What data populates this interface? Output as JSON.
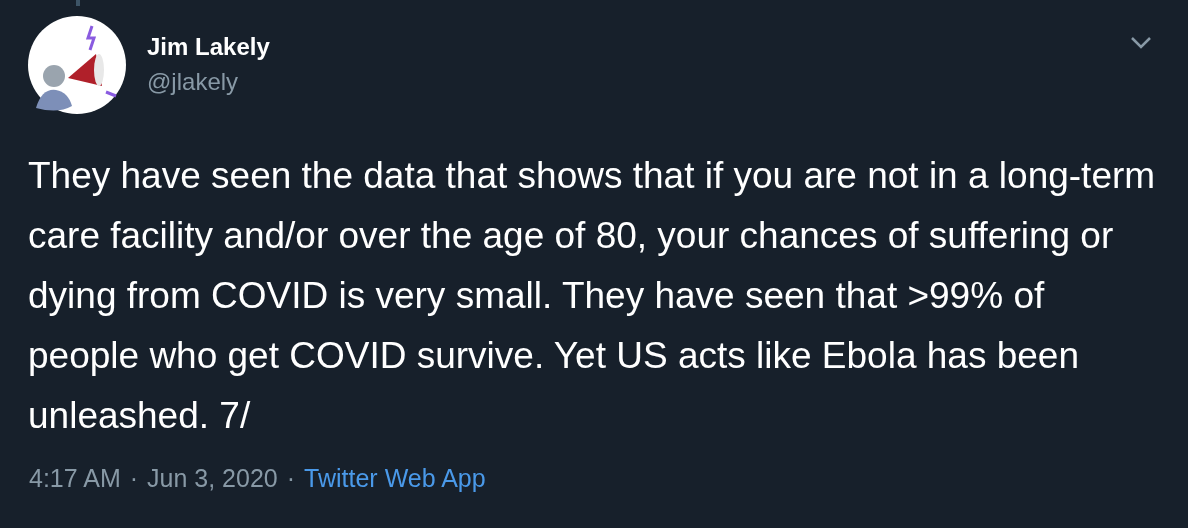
{
  "author": {
    "name": "Jim Lakely",
    "handle": "@jlakely"
  },
  "text": "They have seen the data that shows that if you are not in a long-term care facility and/or over the age of 80, your chances of suffering or dying from COVID is very small. They have seen that >99% of people who get COVID survive. Yet US acts like Ebola has been unleashed. 7/",
  "meta": {
    "time": "4:17 AM",
    "separator_1": "·",
    "date": "Jun 3, 2020",
    "separator_2": "·",
    "source": "Twitter Web App"
  }
}
